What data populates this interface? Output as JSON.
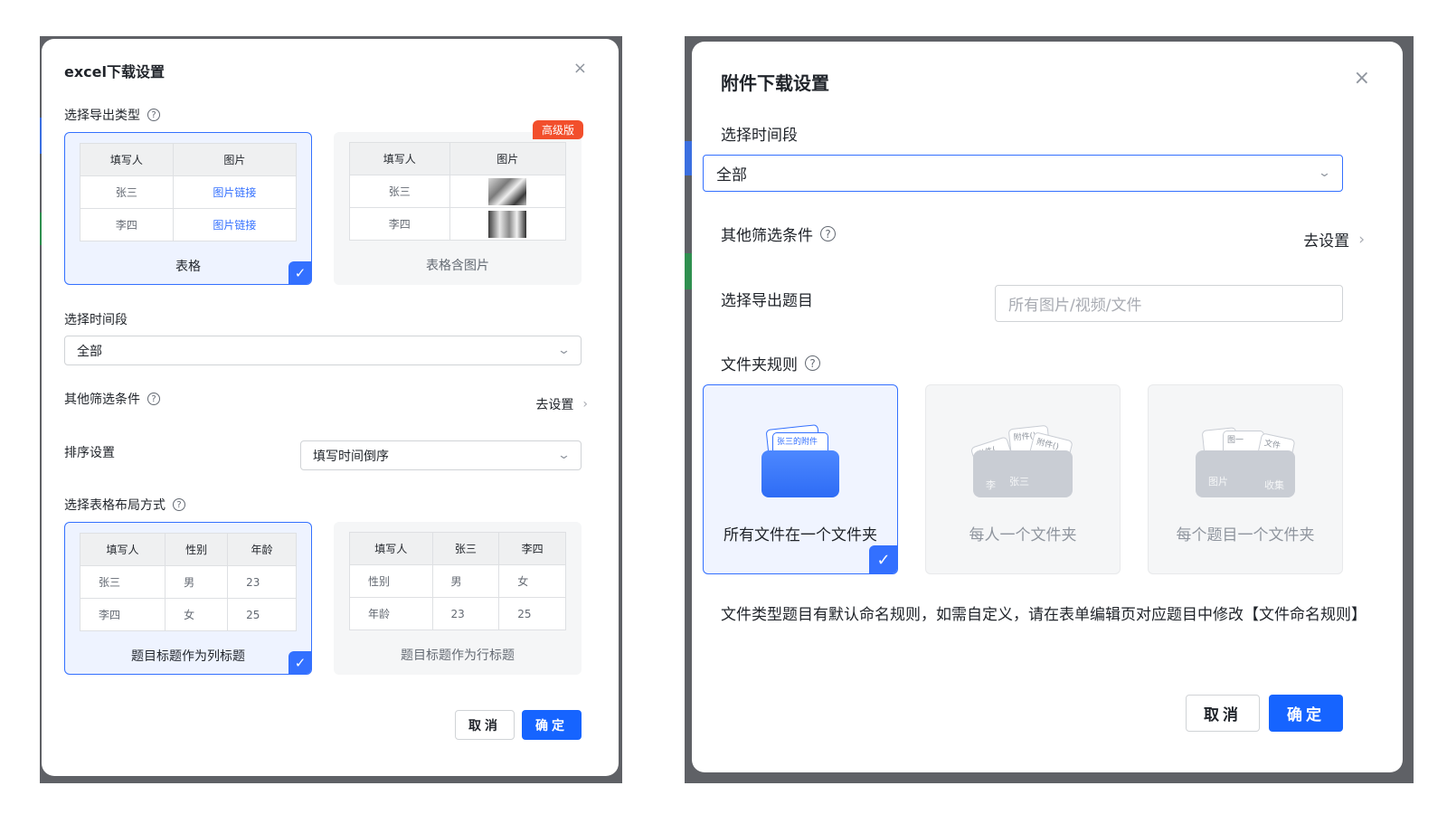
{
  "excel_dialog": {
    "title": "excel下载设置",
    "close_symbol": "×",
    "export_type": {
      "label": "选择导出类型",
      "options": [
        {
          "caption": "表格",
          "selected": true,
          "headers": [
            "填写人",
            "图片"
          ],
          "rows": [
            [
              "张三",
              "图片链接"
            ],
            [
              "李四",
              "图片链接"
            ]
          ]
        },
        {
          "caption": "表格含图片",
          "selected": false,
          "badge": "高级版",
          "headers": [
            "填写人",
            "图片"
          ],
          "rows": [
            [
              "张三"
            ],
            [
              "李四"
            ]
          ]
        }
      ]
    },
    "time_range": {
      "label": "选择时间段",
      "value": "全部"
    },
    "filters": {
      "label": "其他筛选条件",
      "action": "去设置"
    },
    "sort": {
      "label": "排序设置",
      "value": "填写时间倒序"
    },
    "layout": {
      "label": "选择表格布局方式",
      "options": [
        {
          "caption": "题目标题作为列标题",
          "selected": true,
          "headers": [
            "填写人",
            "性别",
            "年龄"
          ],
          "rows": [
            [
              "张三",
              "男",
              "23"
            ],
            [
              "李四",
              "女",
              "25"
            ]
          ]
        },
        {
          "caption": "题目标题作为行标题",
          "selected": false,
          "headers": [
            "填写人",
            "张三",
            "李四"
          ],
          "rows": [
            [
              "性别",
              "男",
              "女"
            ],
            [
              "年龄",
              "23",
              "25"
            ]
          ]
        }
      ]
    },
    "buttons": {
      "cancel": "取消",
      "confirm": "确定"
    }
  },
  "attach_dialog": {
    "title": "附件下载设置",
    "close_symbol": "×",
    "time_range": {
      "label": "选择时间段",
      "value": "全部"
    },
    "filters": {
      "label": "其他筛选条件",
      "action": "去设置"
    },
    "questions": {
      "label": "选择导出题目",
      "placeholder": "所有图片/视频/文件"
    },
    "folder_rule": {
      "label": "文件夹规则",
      "options": [
        {
          "caption": "所有文件在一个文件夹",
          "selected": true,
          "papers": [
            "",
            "张三的附件"
          ],
          "body_text": []
        },
        {
          "caption": "每人一个文件夹",
          "selected": false,
          "papers": [
            "附件(",
            "附件()",
            "附件()"
          ],
          "body_text": [
            "李",
            "张三"
          ]
        },
        {
          "caption": "每个题目一个文件夹",
          "selected": false,
          "papers": [
            "",
            "图一",
            "文件"
          ],
          "body_text": [
            "图片",
            "收集"
          ]
        }
      ]
    },
    "note": "文件类型题目有默认命名规则，如需自定义，请在表单编辑页对应题目中修改【文件命名规则】",
    "buttons": {
      "cancel": "取消",
      "confirm": "确定"
    }
  },
  "colors": {
    "primary": "#1664ff",
    "selected_border": "#3370ff",
    "badge": "#f24f2c"
  }
}
